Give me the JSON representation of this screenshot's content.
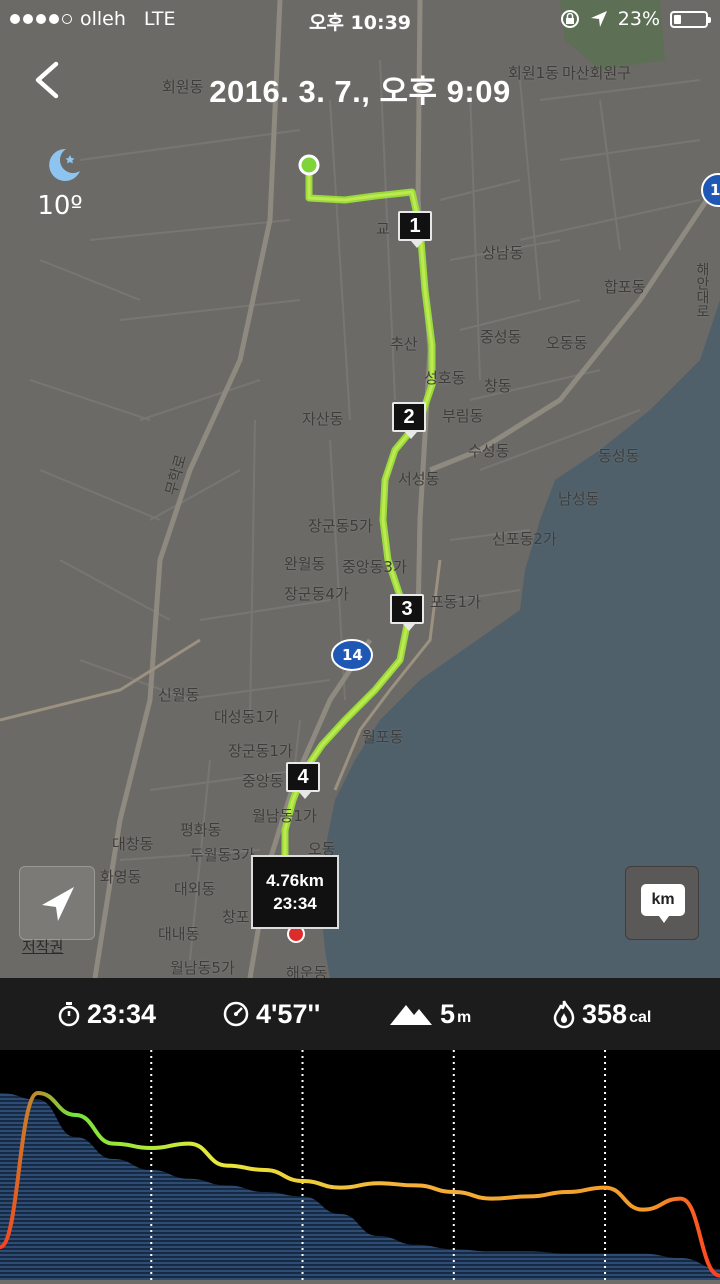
{
  "status_bar": {
    "carrier": "olleh",
    "network": "LTE",
    "time": "오후 10:39",
    "battery": "23%",
    "battery_level": 0.23
  },
  "header": {
    "title": "2016. 3. 7., 오후 9:09"
  },
  "weather": {
    "icon": "moon-icon",
    "temperature": "10º"
  },
  "map": {
    "labels": [
      "회원동",
      "회원1동",
      "마산회원구",
      "교",
      "상남동",
      "합포동",
      "추산",
      "중성동",
      "오동동",
      "해안대로",
      "성호동",
      "창동",
      "자산동",
      "부림동",
      "수성동",
      "동성동",
      "서성동",
      "남성동",
      "무학로",
      "장군동5가",
      "신포동2가",
      "완월동",
      "중앙동3가",
      "장군동4가",
      "포동1가",
      "신월동",
      "대성동1가",
      "월포동",
      "장군동1가",
      "중앙동",
      "월남동1가",
      "대창동",
      "평화동",
      "두월동3가",
      "오동",
      "화영동",
      "대외동",
      "창포",
      "대내동",
      "월남동5가",
      "해운동"
    ],
    "road_badge": "14",
    "road_badge_right": "1",
    "split_markers": [
      "1",
      "2",
      "3",
      "4"
    ],
    "summary": {
      "distance": "4.76km",
      "time": "23:34"
    },
    "locate_icon": "location-arrow-icon",
    "copyright": "저작권",
    "unit_button": "km"
  },
  "stats": {
    "duration": "23:34",
    "pace": "4'57''",
    "elevation": "5",
    "elevation_unit": "m",
    "calories": "358",
    "calories_unit": "cal"
  },
  "chart_data": {
    "type": "area",
    "title": "",
    "x": [
      0,
      0.25,
      0.5,
      0.75,
      1.0,
      1.25,
      1.5,
      1.75,
      2.0,
      2.25,
      2.5,
      2.75,
      3.0,
      3.25,
      3.5,
      3.75,
      4.0,
      4.25,
      4.5,
      4.76
    ],
    "series": [
      {
        "values": [
          0.15,
          0.85,
          0.75,
          0.62,
          0.6,
          0.62,
          0.52,
          0.5,
          0.45,
          0.42,
          0.44,
          0.43,
          0.4,
          0.37,
          0.38,
          0.4,
          0.42,
          0.32,
          0.37,
          0.02
        ]
      },
      {
        "values": [
          0.85,
          0.82,
          0.65,
          0.55,
          0.5,
          0.46,
          0.43,
          0.4,
          0.38,
          0.3,
          0.2,
          0.16,
          0.14,
          0.13,
          0.13,
          0.12,
          0.12,
          0.12,
          0.1,
          0.05
        ]
      }
    ],
    "split_lines_km": [
      1,
      2,
      3,
      4
    ],
    "grid": false,
    "legend": "none"
  }
}
